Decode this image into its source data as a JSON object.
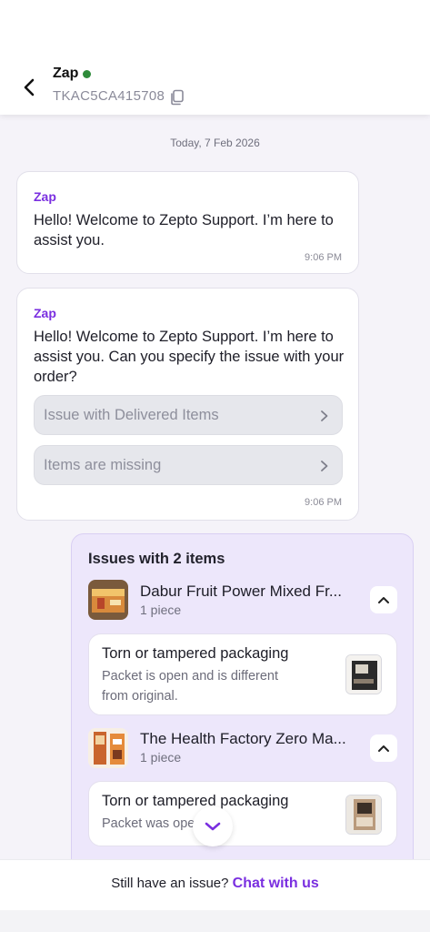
{
  "header": {
    "agent_name": "Zap",
    "ticket_id": "TKAC5CA415708",
    "status_color": "#2e8b3a",
    "icons": {
      "back": "chevron-left-icon",
      "copy": "copy-icon"
    }
  },
  "chat": {
    "date_label": "Today, 7 Feb 2026",
    "messages": [
      {
        "sender": "Zap",
        "text": "Hello! Welcome to Zepto Support. I’m here to assist you.",
        "time": "9:06 PM"
      },
      {
        "sender": "Zap",
        "text": "Hello! Welcome to Zepto Support. I’m here to assist you. Can you specify the issue with your order?",
        "options": [
          "Issue with Delivered Items",
          "Items are missing"
        ],
        "time": "9:06 PM"
      }
    ],
    "issues": {
      "title": "Issues with 2 items",
      "items": [
        {
          "name": "Dabur Fruit Power Mixed Fr...",
          "qty": "1 piece",
          "issue_type": "Torn or tampered packaging",
          "issue_desc": "Packet is open and is different from original."
        },
        {
          "name": "The Health Factory Zero Ma...",
          "qty": "1 piece",
          "issue_type": "Torn or tampered packaging",
          "issue_desc": "Packet was ope"
        }
      ]
    }
  },
  "footer": {
    "prompt": "Still have an issue?",
    "cta": "Chat with us"
  },
  "colors": {
    "accent": "#7a2fe0",
    "issues_bg": "#ede7fb"
  }
}
